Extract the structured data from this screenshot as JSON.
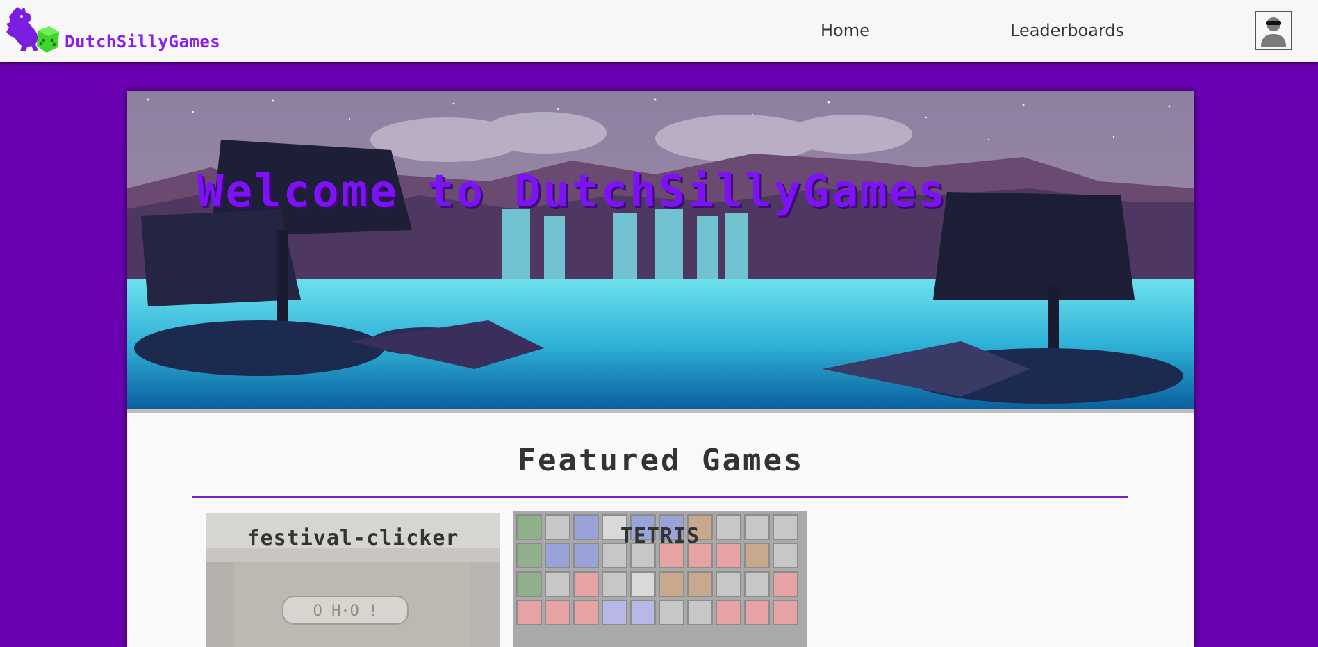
{
  "navbar": {
    "brand": "DutchSillyGames",
    "home_label": "Home",
    "leaderboards_label": "Leaderboards"
  },
  "hero": {
    "title": "Welcome to DutchSillyGames"
  },
  "featured": {
    "heading": "Featured Games",
    "games": [
      {
        "title": "festival-clicker"
      },
      {
        "title": "TETRIS"
      }
    ]
  },
  "colors": {
    "background": "#6b00b3",
    "accent": "#7d12f5",
    "brand": "#8a1df0",
    "navbar": "#f7f7f7",
    "panel": "#f9f9f9",
    "logo_dice": "#3ed62b"
  },
  "icons": [
    "lion-logo-icon",
    "dice-icon",
    "user-avatar-icon"
  ]
}
